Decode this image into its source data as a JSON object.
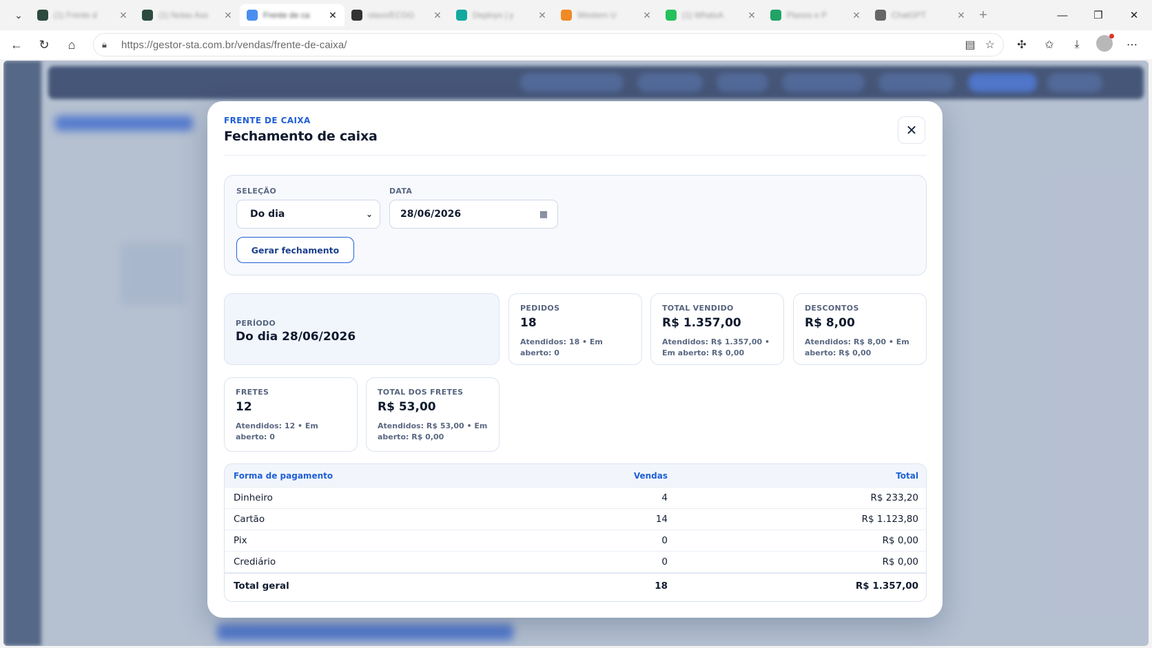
{
  "browser": {
    "tabs": [
      {
        "title": "(1) Frente d",
        "color": "#2d4a3e",
        "active": false
      },
      {
        "title": "(1) Notas Ass",
        "color": "#2d4a3e",
        "active": false
      },
      {
        "title": "Frente de ca",
        "color": "#4a8ff0",
        "active": true
      },
      {
        "title": "olavo/ECGG",
        "color": "#333333",
        "active": false
      },
      {
        "title": "Deploys | y",
        "color": "#12a9a0",
        "active": false
      },
      {
        "title": "Western U",
        "color": "#f08a24",
        "active": false
      },
      {
        "title": "(1) WhatsA",
        "color": "#25c15a",
        "active": false
      },
      {
        "title": "Planos e P",
        "color": "#21a366",
        "active": false
      },
      {
        "title": "ChatGPT",
        "color": "#666666",
        "active": false
      }
    ],
    "url_host": "https://gestor-sta.com.br",
    "url_path": "/vendas/frente-de-caixa/"
  },
  "modal": {
    "kicker": "FRENTE DE CAIXA",
    "title": "Fechamento de caixa",
    "filters": {
      "selection_label": "SELEÇÃO",
      "selection_value": "Do dia",
      "date_label": "DATA",
      "date_value": "28/06/2026",
      "generate_label": "Gerar fechamento"
    },
    "period": {
      "label": "PERÍODO",
      "value": "Do dia 28/06/2026"
    },
    "cards": {
      "pedidos": {
        "label": "PEDIDOS",
        "value": "18",
        "sub": "Atendidos: 18 • Em aberto: 0"
      },
      "total_vendido": {
        "label": "TOTAL VENDIDO",
        "value": "R$ 1.357,00",
        "sub": "Atendidos: R$ 1.357,00 • Em aberto: R$ 0,00"
      },
      "descontos": {
        "label": "DESCONTOS",
        "value": "R$ 8,00",
        "sub": "Atendidos: R$ 8,00 • Em aberto: R$ 0,00"
      },
      "fretes": {
        "label": "FRETES",
        "value": "12",
        "sub": "Atendidos: 12 • Em aberto: 0"
      },
      "total_fretes": {
        "label": "TOTAL DOS FRETES",
        "value": "R$ 53,00",
        "sub": "Atendidos: R$ 53,00 • Em aberto: R$ 0,00"
      }
    },
    "payments": {
      "headers": [
        "Forma de pagamento",
        "Vendas",
        "Total"
      ],
      "rows": [
        [
          "Dinheiro",
          "4",
          "R$ 233,20"
        ],
        [
          "Cartão",
          "14",
          "R$ 1.123,80"
        ],
        [
          "Pix",
          "0",
          "R$ 0,00"
        ],
        [
          "Crediário",
          "0",
          "R$ 0,00"
        ]
      ],
      "total": [
        "Total geral",
        "18",
        "R$ 1.357,00"
      ]
    }
  }
}
